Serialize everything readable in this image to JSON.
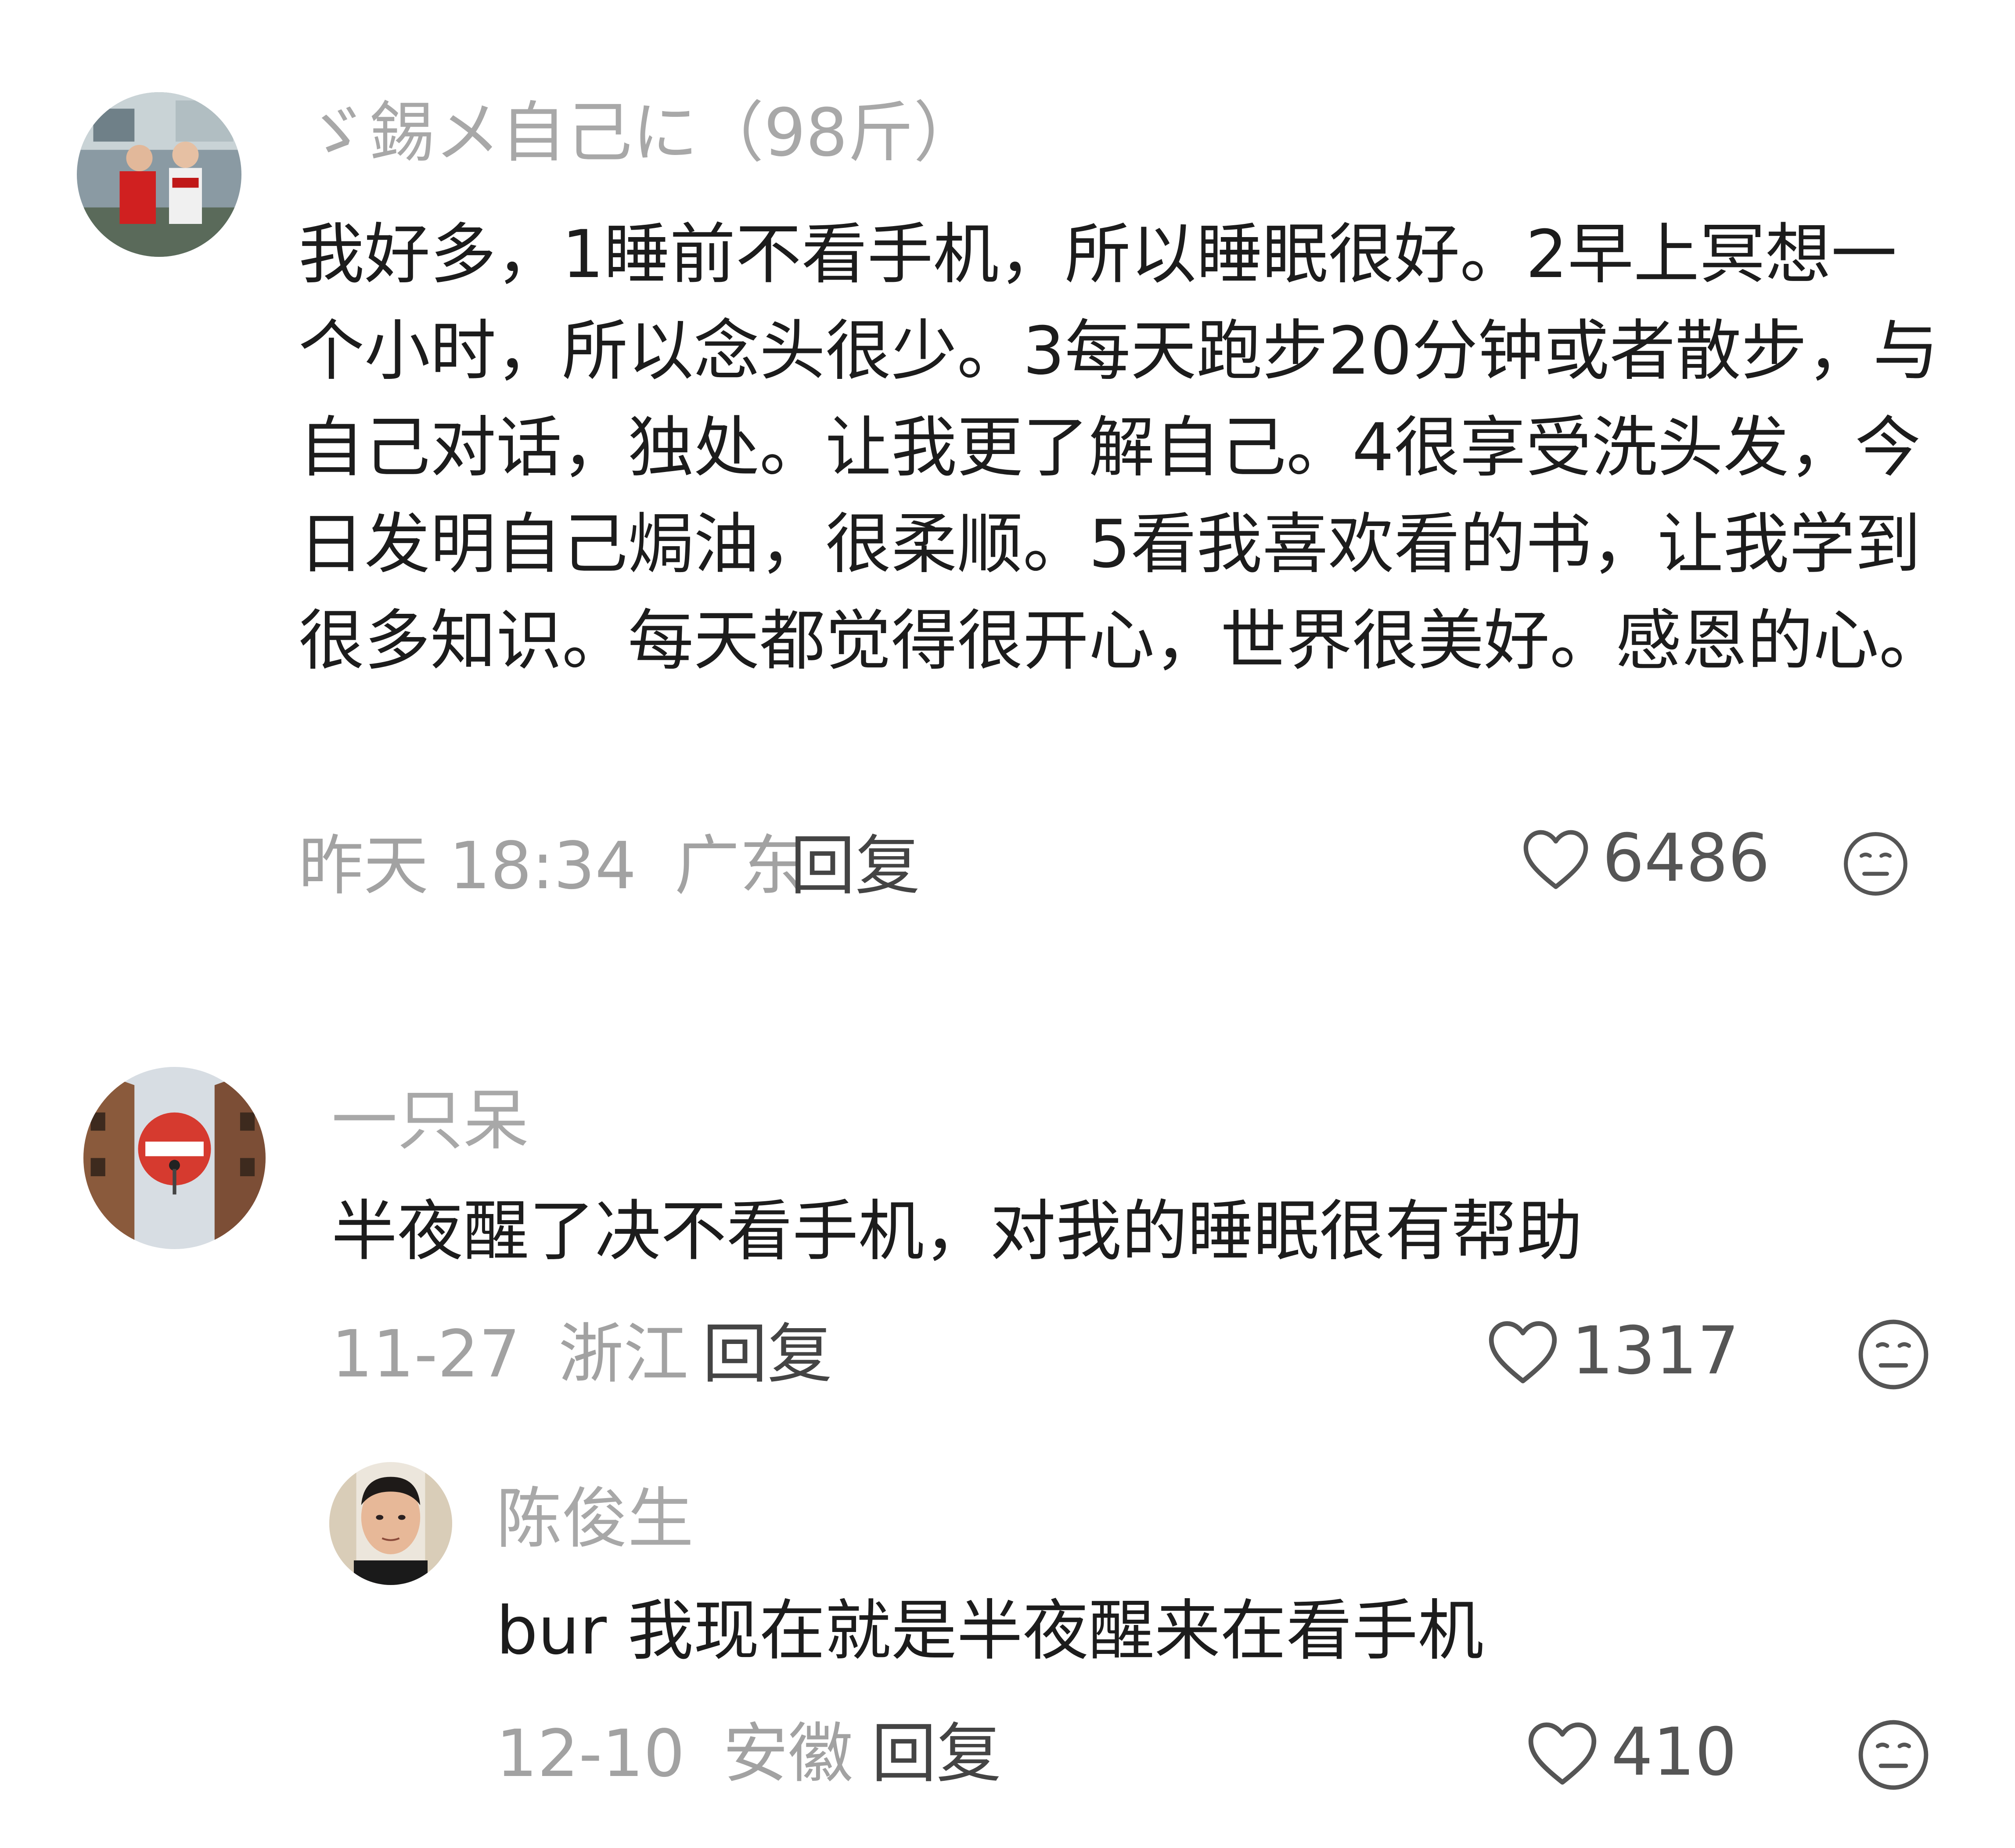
{
  "comments": [
    {
      "username": "ゞ錫メ自己に（98斤）",
      "text": "我好多，1睡前不看手机，所以睡眠很好。2早上冥想一个小时，所以念头很少。3每天跑步20分钟或者散步，与自己对话，独处。让我更了解自己。4很享受洗头发，今日发明自己焗油，很柔顺。5看我喜欢看的书，让我学到很多知识。每天都觉得很开心，世界很美好。感恩的心。",
      "time": "昨天 18:34",
      "location": "广东",
      "reply_label": "回复",
      "likes": "6486"
    },
    {
      "username": "一只呆",
      "text": "半夜醒了决不看手机，对我的睡眠很有帮助",
      "time": "11-27",
      "location": "浙江",
      "reply_label": "回复",
      "likes": "1317"
    },
    {
      "username": "陈俊生",
      "text": "bur 我现在就是半夜醒来在看手机",
      "time": "12-10",
      "location": "安徽",
      "reply_label": "回复",
      "likes": "410"
    }
  ],
  "icons": {
    "like": "heart-outline-icon",
    "dislike": "neutral-face-icon"
  },
  "colors": {
    "username": "#a8a8a8",
    "content": "#1c1c1c",
    "meta": "#a2a2a2",
    "reply": "#444444"
  }
}
